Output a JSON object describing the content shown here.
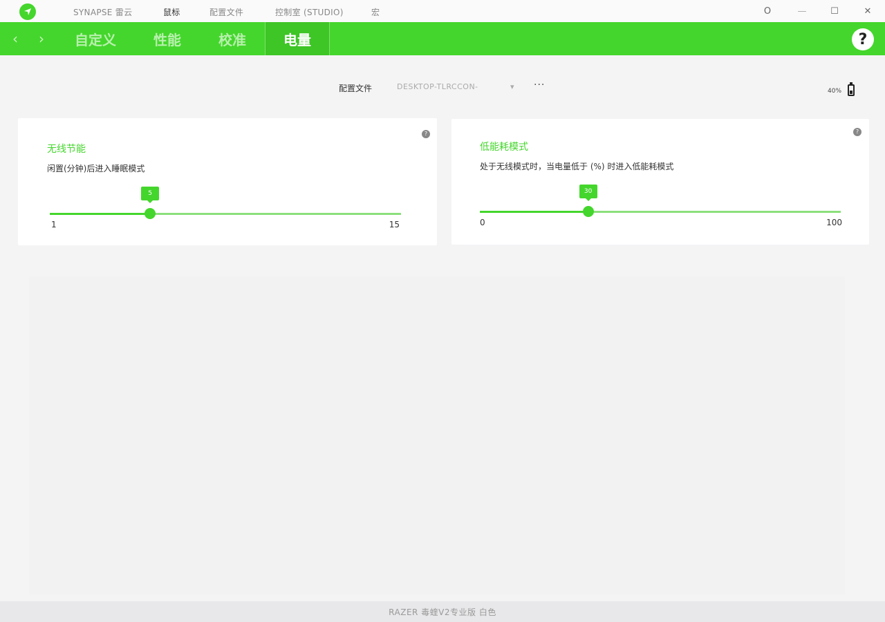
{
  "titlebar": {
    "nav": [
      "SYNAPSE 雷云",
      "鼠标",
      "配置文件",
      "控制室 (STUDIO)",
      "宏"
    ],
    "active_nav": "鼠标",
    "window_controls": {
      "minimize": "—",
      "maximize": "☐",
      "close": "✕",
      "account": "O"
    }
  },
  "tabs": [
    {
      "label": "自定义",
      "active": false
    },
    {
      "label": "性能",
      "active": false
    },
    {
      "label": "校准",
      "active": false
    },
    {
      "label": "电量",
      "active": true
    }
  ],
  "tabbar": {
    "back_icon": "‹",
    "forward_icon": "›",
    "help": "?"
  },
  "profile": {
    "label": "配置文件",
    "value": "DESKTOP-TLRCCON-",
    "dropdown_icon": "▾",
    "more": "···"
  },
  "battery": {
    "percent_text": "40%",
    "level": 0.4
  },
  "cards": [
    {
      "title": "无线节能",
      "description": "闲置(分钟)后进入睡眠模式",
      "info": "?",
      "slider": {
        "min": 1,
        "max": 15,
        "value": 5,
        "min_label": "1",
        "max_label": "15",
        "value_label": "5"
      }
    },
    {
      "title": "低能耗模式",
      "description": "处于无线模式时，当电量低于 (%) 时进入低能耗模式",
      "info": "?",
      "slider": {
        "min": 0,
        "max": 100,
        "value": 30,
        "min_label": "0",
        "max_label": "100",
        "value_label": "30"
      }
    }
  ],
  "footer": {
    "device": "RAZER 毒蝰V2专业版 白色"
  },
  "colors": {
    "accent": "#44d62c",
    "background": "#f4f4f5"
  }
}
